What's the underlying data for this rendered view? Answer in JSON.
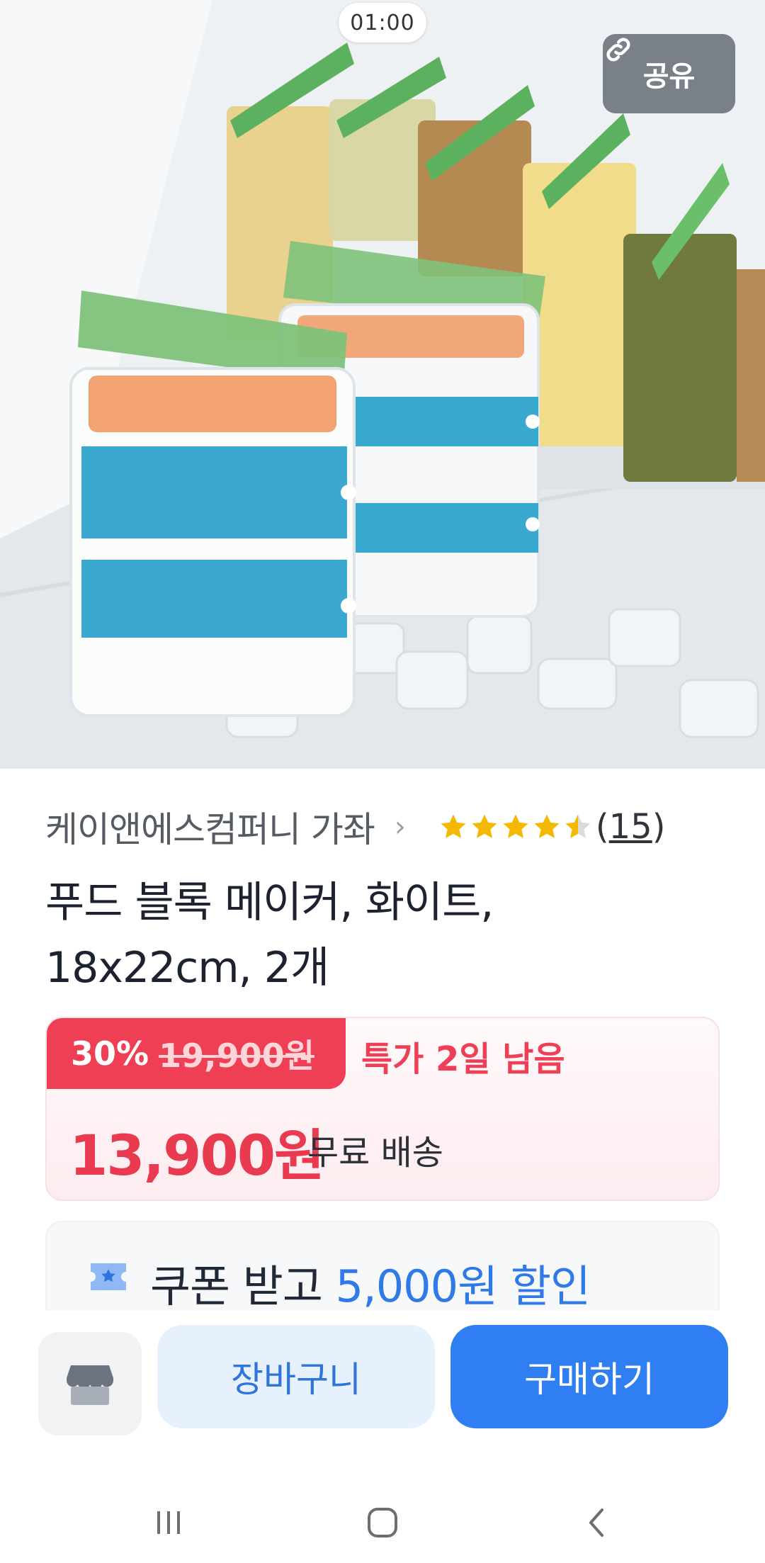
{
  "hero": {
    "timer": "01:00",
    "share_label": "공유"
  },
  "product": {
    "seller": "케이앤에스컴퍼니 가좌",
    "rating": 4.5,
    "review_count_prefix": "(",
    "review_count": "15",
    "review_count_suffix": ")",
    "title_line1": "푸드 블록 메이커, 화이트,",
    "title_line2": "18x22cm, 2개"
  },
  "price": {
    "discount_rate": "30%",
    "original_price": "19,900원",
    "special_offer": "특가 2일 남음",
    "sale_price": "13,900원",
    "shipping": "무료 배송"
  },
  "coupon": {
    "text_prefix": "쿠폰 받고 ",
    "amount": "5,000원 할인"
  },
  "actions": {
    "cart_label": "장바구니",
    "buy_label": "구매하기"
  },
  "colors": {
    "accent_blue": "#2f7ef2",
    "sale_red": "#e93b4f",
    "star_yellow": "#f5b800"
  }
}
